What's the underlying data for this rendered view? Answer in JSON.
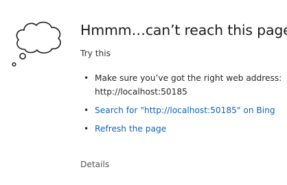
{
  "error_page": {
    "title": "Hmmm…can’t reach this page",
    "try_this": "Try this",
    "suggestions": [
      {
        "line1": "Make sure you’ve got the right web address:",
        "line2": "http://localhost:50185"
      },
      {
        "link": "Search for \"http://localhost:50185\" on Bing"
      },
      {
        "link": "Refresh the page"
      }
    ],
    "details": "Details",
    "bullet": "•"
  },
  "icons": {
    "illustration": "thought-cloud-icon"
  },
  "colors": {
    "link": "#0e64b7",
    "text": "#1b1b1b",
    "muted": "#555555"
  }
}
